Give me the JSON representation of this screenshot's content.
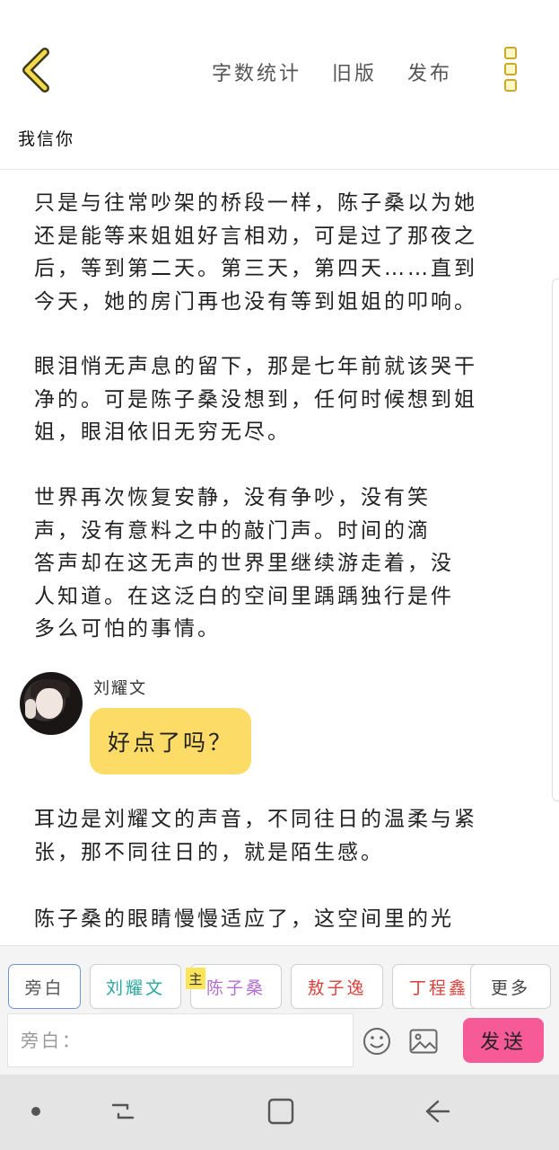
{
  "topbar": {
    "actions": [
      "字数统计",
      "旧版",
      "发布"
    ],
    "accent_color": "#f4d94e"
  },
  "title": "我信你",
  "paragraphs": [
    [
      "只是与往常吵架的桥段一样，陈子桑以为她",
      "还是能等来姐姐好言相劝，可是过了那夜之",
      "后，等到第二天。第三天，第四天……直到",
      "今天，她的房门再也没有等到姐姐的叩响。"
    ],
    [
      "眼泪悄无声息的留下，那是七年前就该哭干",
      "净的。可是陈子桑没想到，任何时候想到姐",
      "姐，眼泪依旧无穷无尽。"
    ],
    [
      "世界再次恢复安静，没有争吵，没有笑",
      "声，没有意料之中的敲门声。时间的滴",
      "答声却在这无声的世界里继续游走着，没",
      "人知道。在这泛白的空间里踽踽独行是件",
      "多么可怕的事情。"
    ],
    [
      "耳边是刘耀文的声音，不同往日的温柔与紧",
      "张，那不同往日的，就是陌生感。"
    ],
    [
      "陈子桑的眼睛慢慢适应了，这空间里的光"
    ]
  ],
  "message": {
    "sender": "刘耀文",
    "text": "好点了吗？",
    "bubble_color": "#fcdb67"
  },
  "characters": [
    {
      "label": "旁白",
      "color": "#555555",
      "active": true
    },
    {
      "label": "刘耀文",
      "color": "#2aa7a1",
      "active": false
    },
    {
      "label": "陈子桑",
      "color": "#b36fd0",
      "active": false,
      "tag": "主"
    },
    {
      "label": "敖子逸",
      "color": "#d9423c",
      "active": false
    },
    {
      "label": "丁程鑫",
      "color": "#d9423c",
      "active": false
    },
    {
      "label": "更多",
      "color": "#444444",
      "active": false
    }
  ],
  "input": {
    "placeholder": "旁白："
  },
  "send_label": "发送",
  "send_color": "#f65b97"
}
